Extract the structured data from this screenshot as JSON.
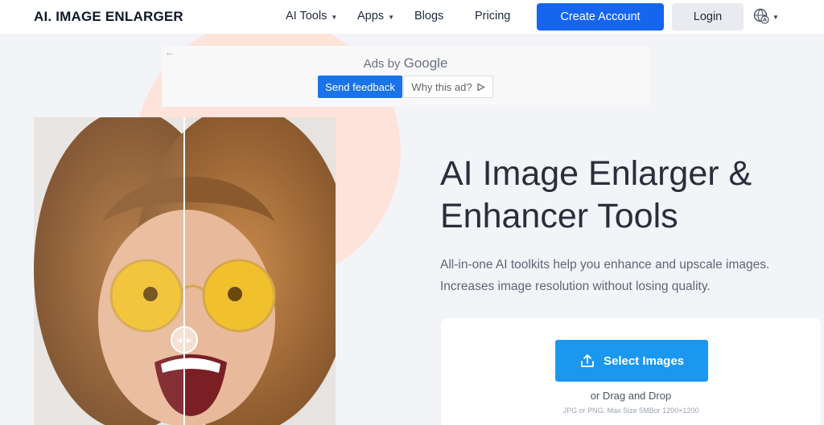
{
  "brand": {
    "logo": "AI. IMAGE ENLARGER"
  },
  "nav": {
    "items": [
      {
        "label": "AI Tools",
        "has_dropdown": true
      },
      {
        "label": "Apps",
        "has_dropdown": true
      },
      {
        "label": "Blogs",
        "has_dropdown": false
      },
      {
        "label": "Pricing",
        "has_dropdown": false
      }
    ],
    "create_account": "Create Account",
    "login": "Login",
    "language_icon": "language-globe-icon"
  },
  "ad": {
    "back_icon": "←",
    "ads_by": "Ads by",
    "google": "Google",
    "send_feedback": "Send feedback",
    "why_this_ad": "Why this ad?"
  },
  "hero": {
    "title_line1": "AI Image Enlarger &",
    "title_line2": "Enhancer Tools",
    "subtitle_line1": "All-in-one AI toolkits help you enhance and upscale images.",
    "subtitle_line2": "Increases image resolution without losing quality."
  },
  "upload": {
    "select_label": "Select Images",
    "drag_text": "or Drag and Drop",
    "limits": "JPG or PNG. Max Size 5MBor 1200×1200"
  },
  "colors": {
    "primary": "#1565f0",
    "select_button": "#1a98f0",
    "accent_circle": "#fde3da",
    "page_bg": "#f3f4f8"
  }
}
